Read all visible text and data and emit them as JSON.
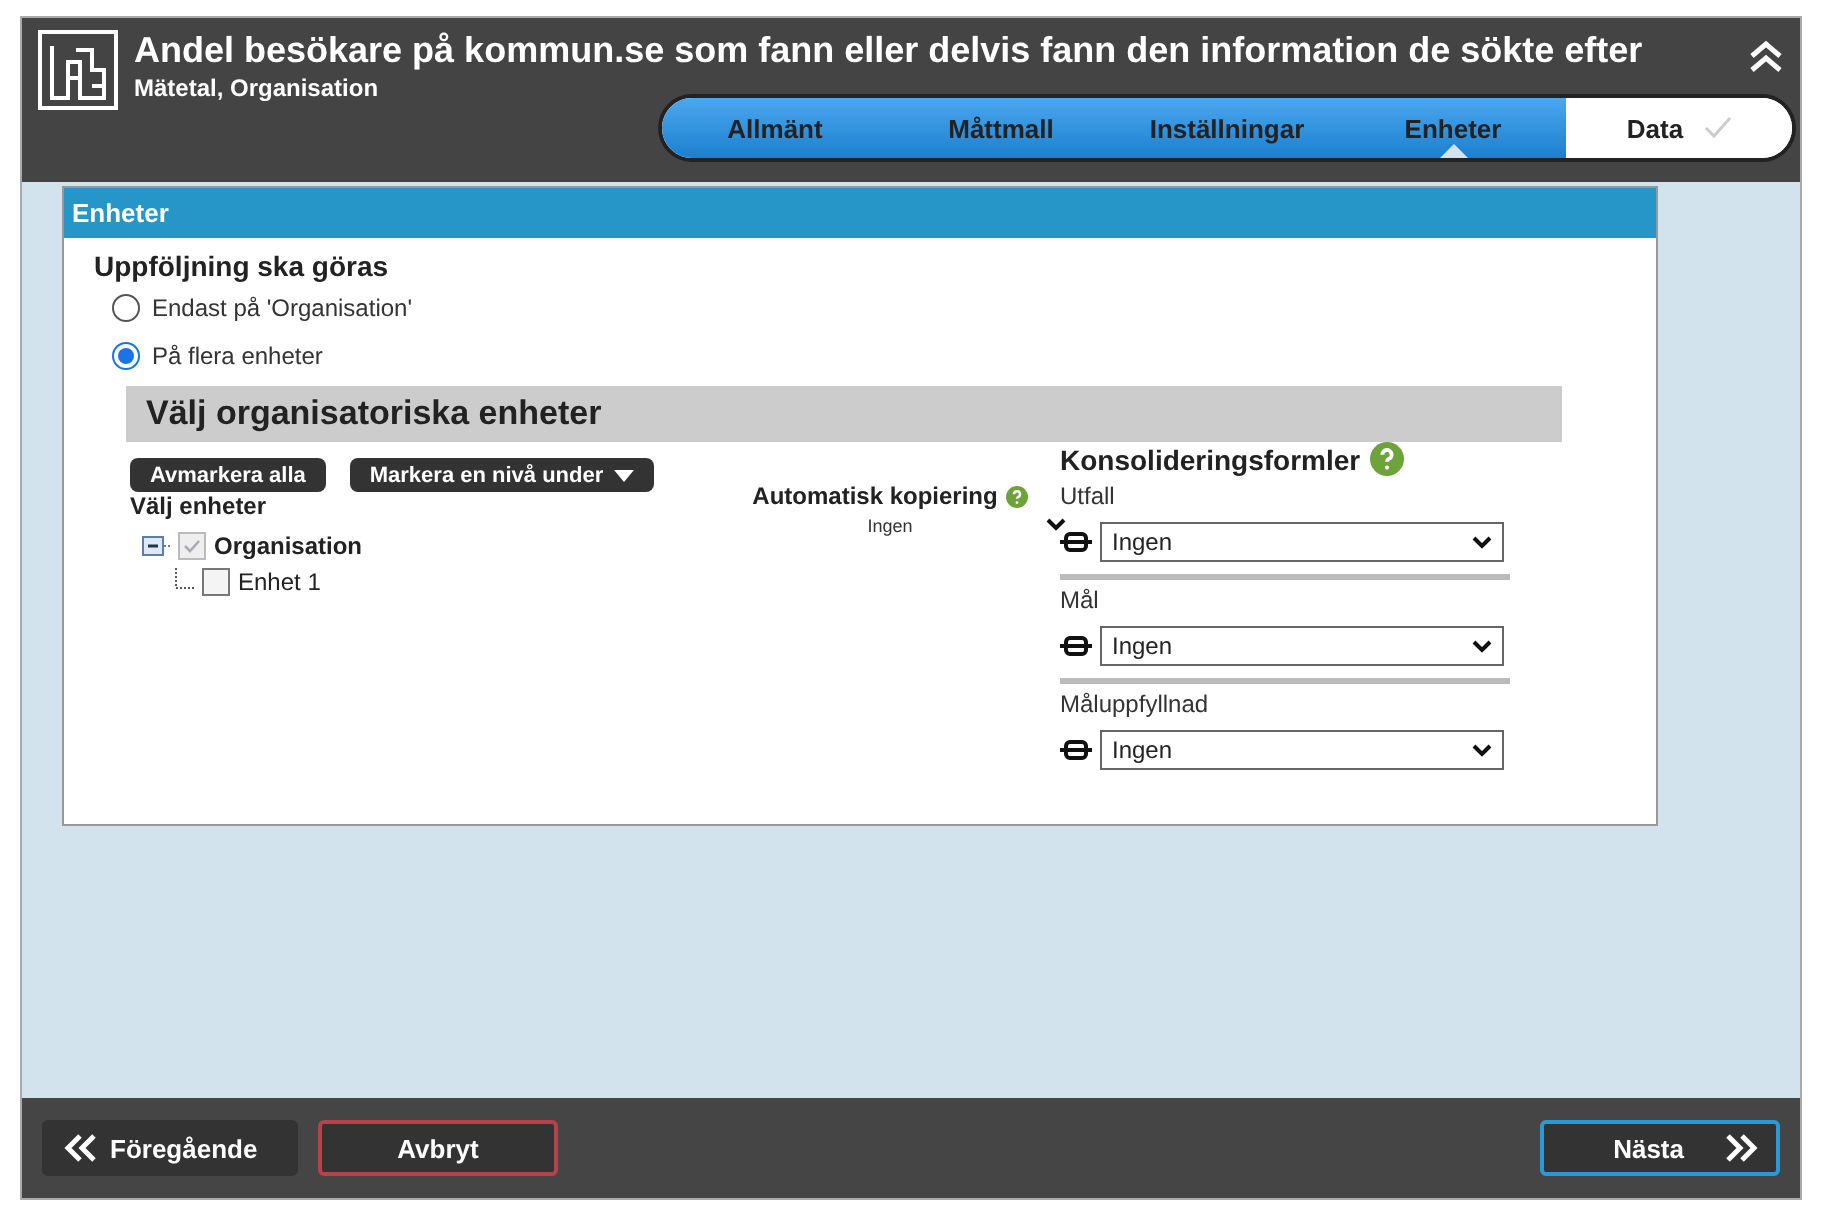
{
  "header": {
    "title": "Andel besökare på kommun.se som fann eller delvis fann den information de sökte efter",
    "subtitle": "Mätetal, Organisation"
  },
  "steps": [
    {
      "label": "Allmänt",
      "reached": true,
      "selected": false
    },
    {
      "label": "Måttmall",
      "reached": true,
      "selected": false
    },
    {
      "label": "Inställningar",
      "reached": true,
      "selected": false
    },
    {
      "label": "Enheter",
      "reached": true,
      "selected": true
    },
    {
      "label": "Data",
      "reached": false,
      "selected": false
    }
  ],
  "panel": {
    "title": "Enheter",
    "question": "Uppföljning ska göras",
    "options": [
      {
        "label": "Endast på 'Organisation'",
        "selected": false
      },
      {
        "label": "På flera enheter",
        "selected": true
      }
    ],
    "section_title": "Välj organisatoriska enheter",
    "buttons": [
      {
        "label": "Avmarkera alla",
        "dropdown": false
      },
      {
        "label": "Markera en nivå under",
        "dropdown": true
      }
    ],
    "tree_label": "Välj enheter",
    "tree": [
      {
        "label": "Organisation",
        "checked": true,
        "disabled": true,
        "expanded": true,
        "children": [
          {
            "label": "Enhet 1",
            "checked": false,
            "disabled": false
          }
        ]
      }
    ],
    "auto_copy": {
      "label": "Automatisk kopiering",
      "value": "Ingen"
    },
    "consolidation": {
      "title": "Konsolideringsformler",
      "fields": [
        {
          "label": "Utfall",
          "value": "Ingen"
        },
        {
          "label": "Mål",
          "value": "Ingen"
        },
        {
          "label": "Måluppfyllnad",
          "value": "Ingen"
        }
      ]
    }
  },
  "footer": {
    "previous": "Föregående",
    "cancel": "Avbryt",
    "next": "Nästa"
  }
}
